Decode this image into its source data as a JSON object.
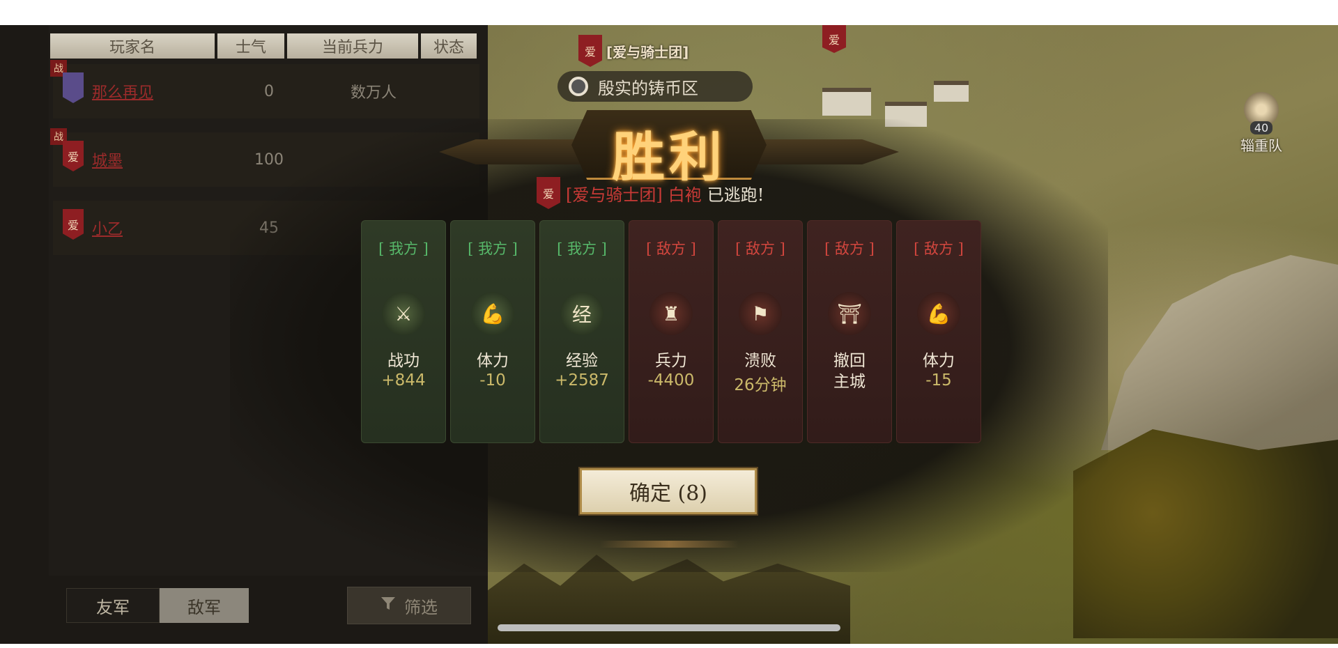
{
  "table": {
    "headers": [
      "玩家名",
      "士气",
      "当前兵力",
      "状态"
    ],
    "rows": [
      {
        "war_tag": "战",
        "flag_char": "",
        "name": "那么再见",
        "morale": "0",
        "troops": "数万人"
      },
      {
        "war_tag": "战",
        "flag_char": "爱",
        "name": "城墨",
        "morale": "100",
        "troops": ""
      },
      {
        "war_tag": "",
        "flag_char": "爱",
        "name": "小乙",
        "morale": "45",
        "troops": ""
      }
    ]
  },
  "tabs": {
    "friend": "友军",
    "enemy": "敌军",
    "filter": "筛选"
  },
  "map": {
    "alliance_flag": "爱",
    "alliance_name": "[爱与骑士团]",
    "region": "殷实的铸币区",
    "top_flag": "爱",
    "supply_level": "40",
    "supply_label": "辎重队"
  },
  "dialog": {
    "title": "胜利",
    "escape_flag": "爱",
    "escape_alliance": "[爱与骑士团]",
    "escape_player": "白袍",
    "escape_text": "已逃跑!",
    "cards": [
      {
        "side": "[ 我方 ]",
        "icon": "merit-icon",
        "glyph": "⚔",
        "label": "战功",
        "value": "+844",
        "kind": "ally"
      },
      {
        "side": "[ 我方 ]",
        "icon": "stamina-icon",
        "glyph": "💪",
        "label": "体力",
        "value": "-10",
        "kind": "ally"
      },
      {
        "side": "[ 我方 ]",
        "icon": "experience-icon",
        "glyph": "经",
        "label": "经验",
        "value": "+2587",
        "kind": "ally"
      },
      {
        "side": "[ 敌方 ]",
        "icon": "troops-icon",
        "glyph": "♜",
        "label": "兵力",
        "value": "-4400",
        "kind": "enemy"
      },
      {
        "side": "[ 敌方 ]",
        "icon": "defeat-flag-icon",
        "glyph": "⚑",
        "label": "溃败",
        "value": "26分钟",
        "kind": "enemy"
      },
      {
        "side": "[ 敌方 ]",
        "icon": "city-gate-icon",
        "glyph": "⛩",
        "label": "撤回\n主城",
        "value": "",
        "kind": "enemy"
      },
      {
        "side": "[ 敌方 ]",
        "icon": "stamina-icon",
        "glyph": "💪",
        "label": "体力",
        "value": "-15",
        "kind": "enemy"
      }
    ],
    "confirm": "确定 (8)"
  }
}
